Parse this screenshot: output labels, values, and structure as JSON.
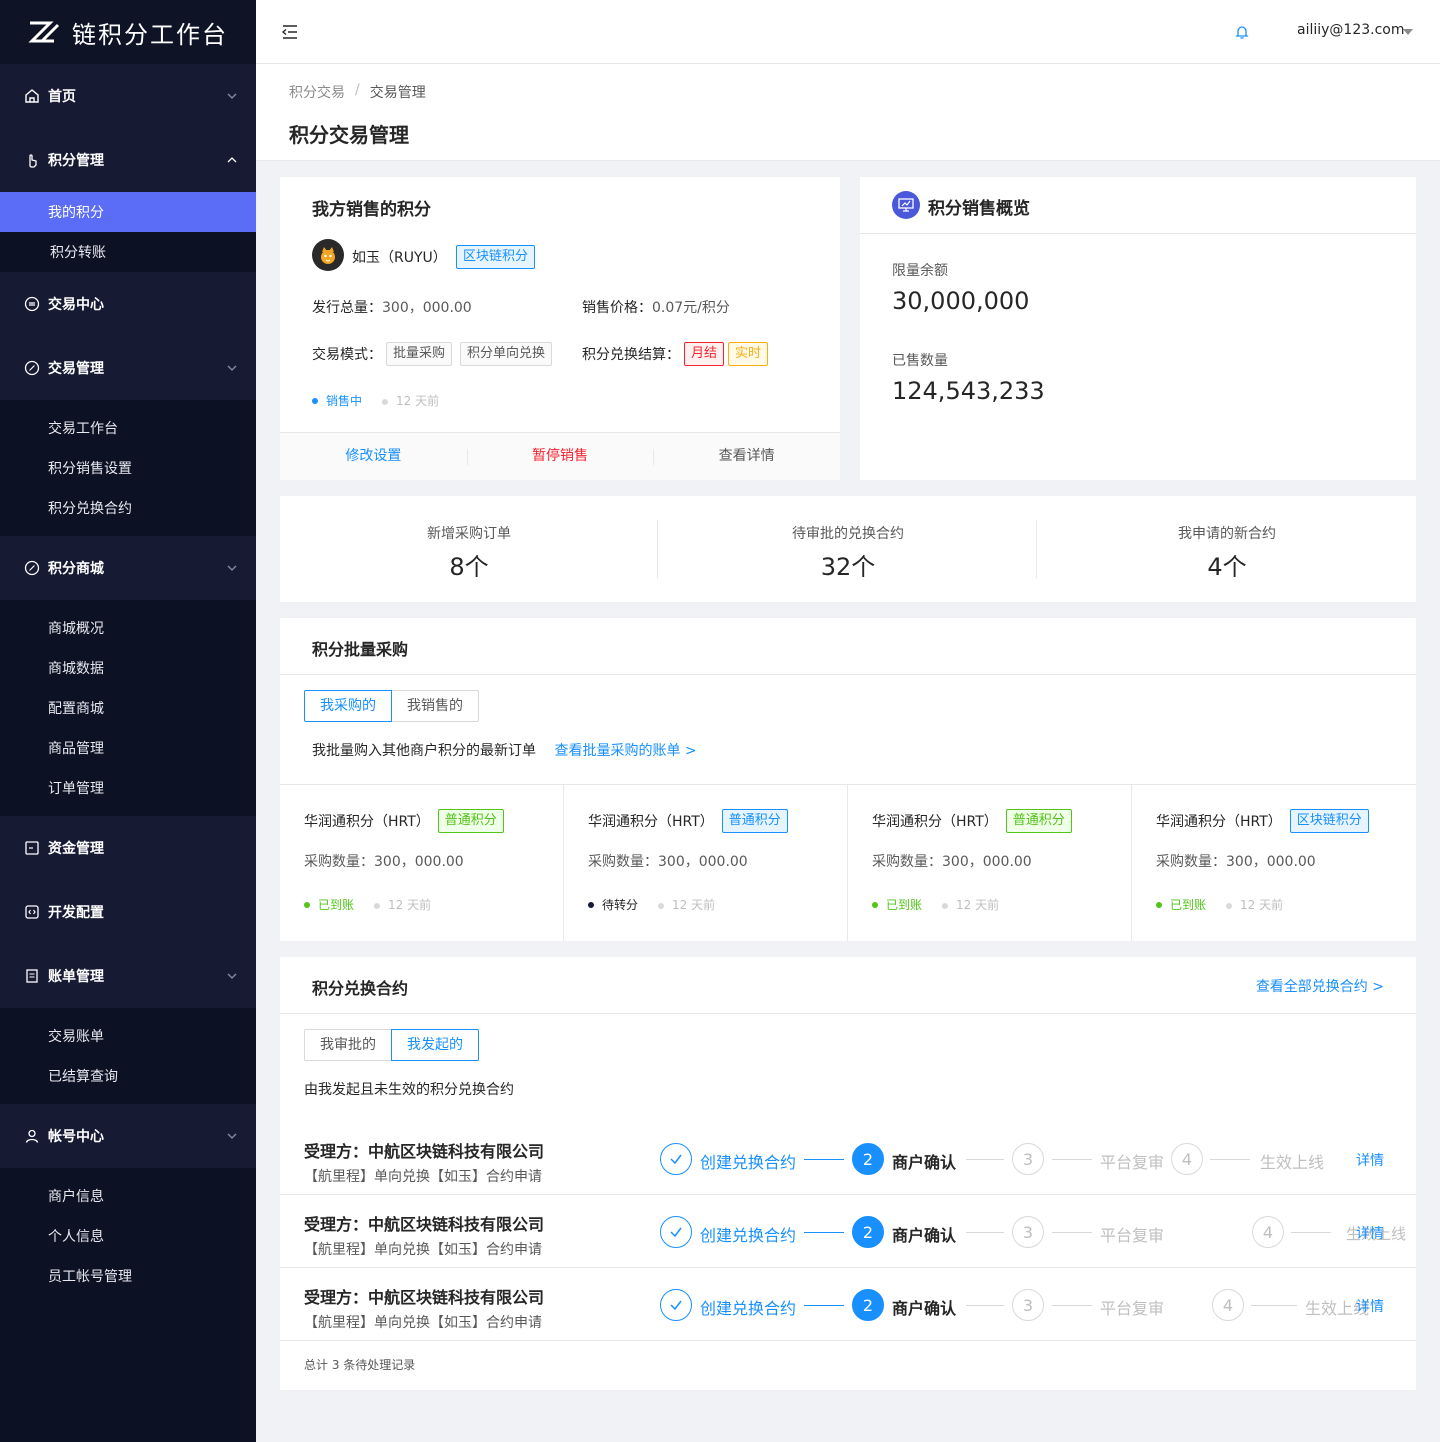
{
  "app": {
    "title": "链积分工作台"
  },
  "sidebar": {
    "home": "首页",
    "points_mgmt": {
      "label": "积分管理",
      "items": [
        "我的积分",
        "积分转账"
      ]
    },
    "trade_center": "交易中心",
    "trade_mgmt": {
      "label": "交易管理",
      "items": [
        "交易工作台",
        "积分销售设置",
        "积分兑换合约"
      ]
    },
    "mall": {
      "label": "积分商城",
      "items": [
        "商城概况",
        "商城数据",
        "配置商城",
        "商品管理",
        "订单管理"
      ]
    },
    "funds": "资金管理",
    "dev": "开发配置",
    "bills": {
      "label": "账单管理",
      "items": [
        "交易账单",
        "已结算查询"
      ]
    },
    "account": {
      "label": "帐号中心",
      "items": [
        "商户信息",
        "个人信息",
        "员工帐号管理"
      ]
    }
  },
  "header": {
    "user": "ailiiy@123.com"
  },
  "breadcrumb": {
    "parent": "积分交易",
    "sep": "/",
    "current": "交易管理"
  },
  "page_title": "积分交易管理",
  "sale": {
    "title": "我方销售的积分",
    "name": "如玉（RUYU）",
    "tag": "区块链积分",
    "total_label": "发行总量：",
    "total_value": "300，000.00",
    "price_label": "销售价格：",
    "price_value": "0.07元/积分",
    "mode_label": "交易模式：",
    "mode_tags": [
      "批量采购",
      "积分单向兑换"
    ],
    "settle_label": "积分兑换结算：",
    "settle_tags": [
      "月结",
      "实时"
    ],
    "status": "销售中",
    "time": "12 天前",
    "actions": {
      "edit": "修改设置",
      "pause": "暂停销售",
      "detail": "查看详情"
    }
  },
  "overview": {
    "title": "积分销售概览",
    "limit_label": "限量余额",
    "limit_value": "30,000,000",
    "sold_label": "已售数量",
    "sold_value": "124,543,233"
  },
  "stats": [
    {
      "label": "新增采购订单",
      "value": "8个"
    },
    {
      "label": "待审批的兑换合约",
      "value": "32个"
    },
    {
      "label": "我申请的新合约",
      "value": "4个"
    }
  ],
  "bulk": {
    "title": "积分批量采购",
    "tabs": [
      "我采购的",
      "我销售的"
    ],
    "desc": "我批量购入其他商户积分的最新订单",
    "link": "查看批量采购的账单 >",
    "items": [
      {
        "name": "华润通积分（HRT）",
        "tag": "普通积分",
        "qty": "采购数量：300，000.00",
        "status": "已到账",
        "time": "12 天前"
      },
      {
        "name": "华润通积分（HRT）",
        "tag": "普通积分",
        "qty": "采购数量：300，000.00",
        "status": "待转分",
        "time": "12 天前"
      },
      {
        "name": "华润通积分（HRT）",
        "tag": "普通积分",
        "qty": "采购数量：300，000.00",
        "status": "已到账",
        "time": "12 天前"
      },
      {
        "name": "华润通积分（HRT）",
        "tag": "区块链积分",
        "qty": "采购数量：300，000.00",
        "status": "已到账",
        "time": "12 天前"
      }
    ]
  },
  "contracts": {
    "title": "积分兑换合约",
    "link": "查看全部兑换合约 >",
    "tabs": [
      "我审批的",
      "我发起的"
    ],
    "desc": "由我发起且未生效的积分兑换合约",
    "steps": [
      "创建兑换合约",
      "商户确认",
      "平台复审",
      "生效上线"
    ],
    "step_numbers": [
      "2",
      "3",
      "4"
    ],
    "detail": "详情",
    "rows": [
      {
        "party": "受理方：中航区块链科技有限公司",
        "sub": "【航里程】单向兑换【如玉】合约申请"
      },
      {
        "party": "受理方：中航区块链科技有限公司",
        "sub": "【航里程】单向兑换【如玉】合约申请"
      },
      {
        "party": "受理方：中航区块链科技有限公司",
        "sub": "【航里程】单向兑换【如玉】合约申请"
      }
    ],
    "footer": "总计 3 条待处理记录"
  },
  "colors": {
    "primary": "#1890ff",
    "sidebar": "#161a33",
    "active": "#5b6cf6",
    "success": "#52c41a",
    "danger": "#f5222d",
    "warning": "#faad14"
  }
}
